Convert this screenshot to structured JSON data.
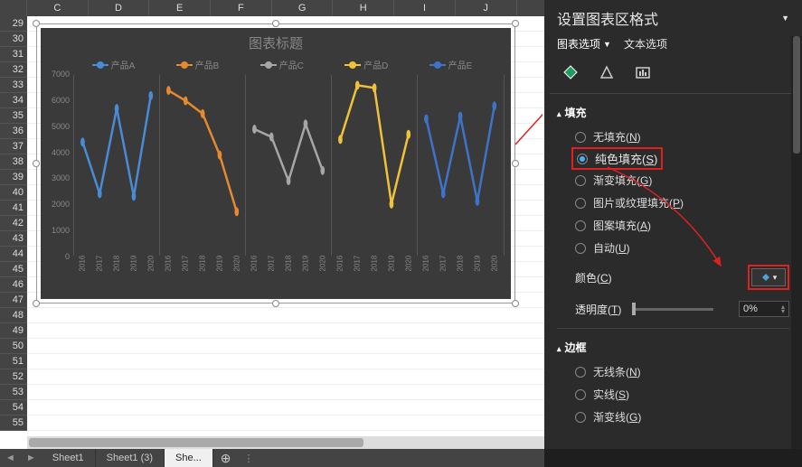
{
  "columns": [
    "C",
    "D",
    "E",
    "F",
    "G",
    "H",
    "I",
    "J"
  ],
  "rows_start": 29,
  "rows_end": 55,
  "chart": {
    "title": "图表标题",
    "yticks": [
      "7000",
      "6000",
      "5000",
      "4000",
      "3000",
      "2000",
      "1000",
      "0"
    ],
    "ymax": 7000
  },
  "chart_data": {
    "type": "line",
    "title": "图表标题",
    "xlabel": "",
    "ylabel": "",
    "ylim": [
      0,
      7000
    ],
    "x": [
      "2016",
      "2017",
      "2018",
      "2019",
      "2020"
    ],
    "series": [
      {
        "name": "产品A",
        "color": "#4a8bd6",
        "values": [
          4400,
          2400,
          5700,
          2300,
          6200
        ]
      },
      {
        "name": "产品B",
        "color": "#e58a2e",
        "values": [
          6400,
          6000,
          5500,
          3900,
          1700
        ]
      },
      {
        "name": "产品C",
        "color": "#a6a6a6",
        "values": [
          4900,
          4600,
          2900,
          5100,
          3300
        ]
      },
      {
        "name": "产品D",
        "color": "#f0c23a",
        "values": [
          4500,
          6600,
          6500,
          2000,
          4700
        ]
      },
      {
        "name": "产品E",
        "color": "#3f73c9",
        "values": [
          5300,
          2400,
          5400,
          2100,
          5800
        ]
      }
    ]
  },
  "sidepane": {
    "title": "设置图表区格式",
    "tabs": {
      "chart_options": "图表选项",
      "text_options": "文本选项"
    },
    "sections": {
      "fill": {
        "label": "填充",
        "options": {
          "none": "无填充(",
          "none_k": "N",
          "solid": "纯色填充(",
          "solid_k": "S",
          "gradient": "渐变填充(",
          "gradient_k": "G",
          "picture": "图片或纹理填充(",
          "picture_k": "P",
          "pattern": "图案填充(",
          "pattern_k": "A",
          "auto": "自动(",
          "auto_k": "U"
        },
        "selected": "solid",
        "color_label": "颜色(",
        "color_k": "C",
        "trans_label": "透明度(",
        "trans_k": "T",
        "trans_value": "0%"
      },
      "border": {
        "label": "边框",
        "options": {
          "none": "无线条(",
          "none_k": "N",
          "solid": "实线(",
          "solid_k": "S",
          "gradient": "渐变线(",
          "gradient_k": "G"
        }
      }
    }
  },
  "tabs": {
    "t1": "Sheet1",
    "t2": "Sheet1 (3)",
    "t3": "She..."
  }
}
